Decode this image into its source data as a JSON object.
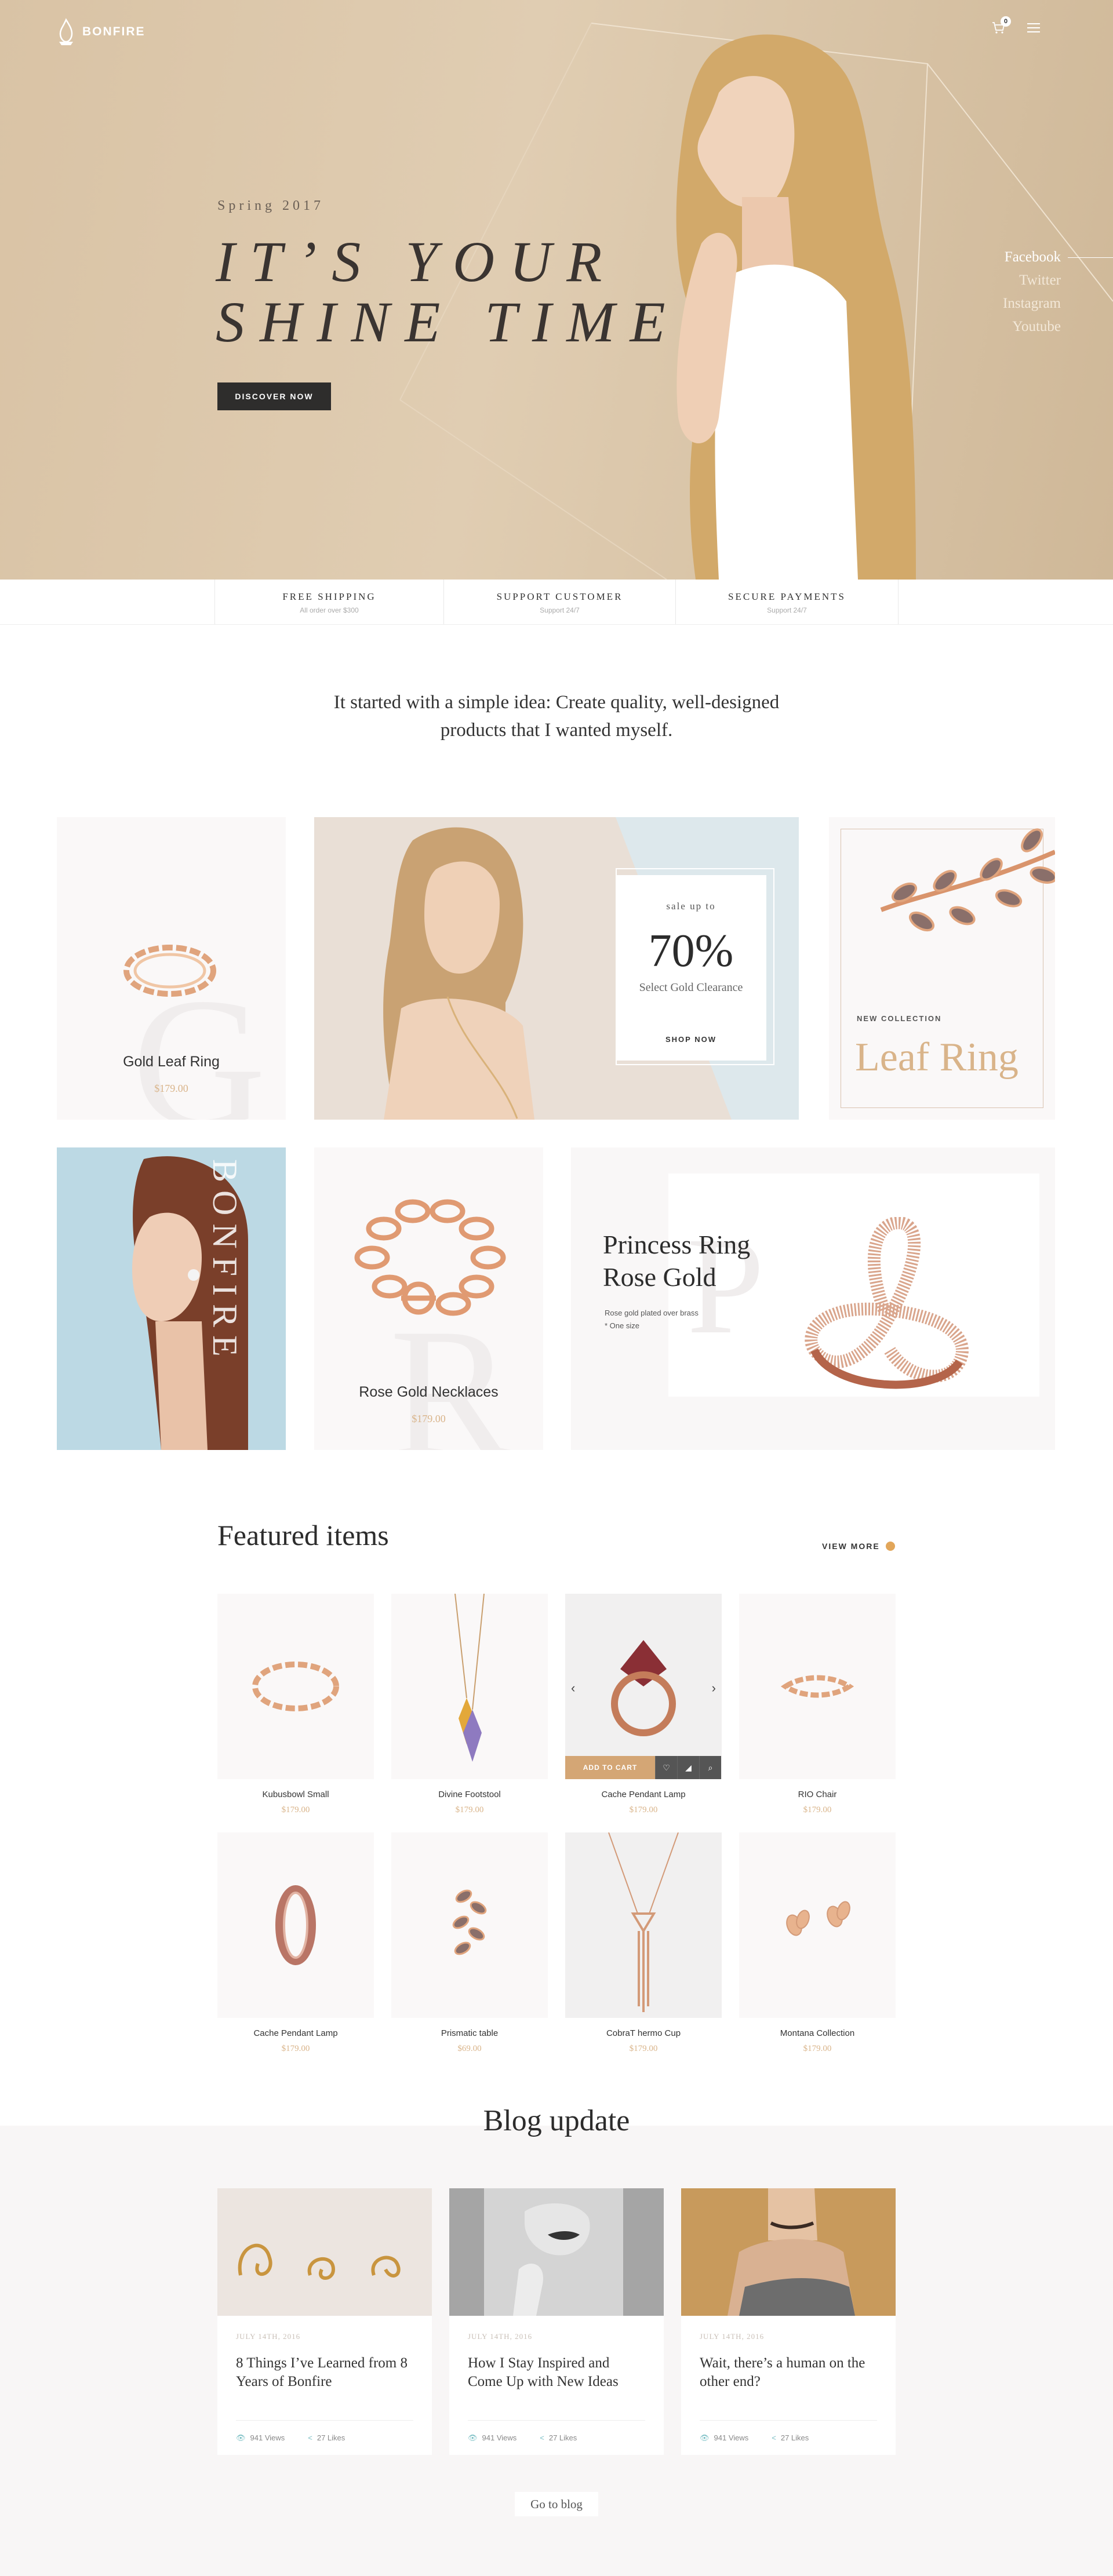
{
  "header": {
    "logo_text": "BONFIRE",
    "cart_count": "0",
    "icons": [
      "cart-icon",
      "menu-icon"
    ]
  },
  "hero": {
    "season": "Spring 2017",
    "headline_line1": "IT’S YOUR",
    "headline_line2": "SHINE TIME",
    "cta": "DISCOVER NOW",
    "social": [
      "Facebook",
      "Twitter",
      "Instagram",
      "Youtube"
    ]
  },
  "features": [
    {
      "title": "FREE SHIPPING",
      "sub": "All order over $300"
    },
    {
      "title": "SUPPORT CUSTOMER",
      "sub": "Support 24/7"
    },
    {
      "title": "SECURE PAYMENTS",
      "sub": "Support 24/7"
    }
  ],
  "intro": {
    "line1": "It started with a simple idea: Create quality, well-designed",
    "line2": "products that I wanted myself."
  },
  "promo": {
    "gold_leaf_ring": {
      "name": "Gold Leaf Ring",
      "price": "$179.00",
      "letter": "G"
    },
    "sale": {
      "kicker": "sale up to",
      "percent": "70%",
      "sub": "Select Gold Clearance",
      "cta": "SHOP NOW"
    },
    "leaf_ring": {
      "kicker": "NEW COLLECTION",
      "title": "Leaf Ring"
    },
    "bonfire_vertical": "BONFIRE",
    "necklaces": {
      "name": "Rose Gold Necklaces",
      "price": "$179.00",
      "letter": "R"
    },
    "princess": {
      "title_line1": "Princess Ring",
      "title_line2": "Rose Gold",
      "desc1": "Rose gold plated over brass",
      "desc2": "* One size",
      "letter": "P"
    }
  },
  "featured": {
    "title": "Featured items",
    "view_more": "VIEW MORE",
    "add_to_cart": "ADD TO CART",
    "items": [
      {
        "name": "Kubusbowl Small",
        "price": "$179.00"
      },
      {
        "name": "Divine Footstool",
        "price": "$179.00"
      },
      {
        "name": "Cache Pendant Lamp",
        "price": "$179.00"
      },
      {
        "name": "RIO Chair",
        "price": "$179.00"
      },
      {
        "name": "Cache Pendant Lamp",
        "price": "$179.00"
      },
      {
        "name": "Prismatic table",
        "price": "$69.00"
      },
      {
        "name": "CobraT hermo Cup",
        "price": "$179.00"
      },
      {
        "name": "Montana Collection",
        "price": "$179.00"
      }
    ]
  },
  "blog": {
    "title": "Blog update",
    "go_to_blog": "Go to blog",
    "posts": [
      {
        "date": "JULY 14TH, 2016",
        "title": "8 Things I’ve Learned from 8 Years of Bonfire",
        "views": "941 Views",
        "likes": "27 Likes"
      },
      {
        "date": "JULY 14TH, 2016",
        "title": "How I Stay Inspired and Come Up with New Ideas",
        "views": "941 Views",
        "likes": "27 Likes"
      },
      {
        "date": "JULY 14TH, 2016",
        "title": "Wait, there’s a human on the other end?",
        "views": "941 Views",
        "likes": "27 Likes"
      }
    ]
  }
}
